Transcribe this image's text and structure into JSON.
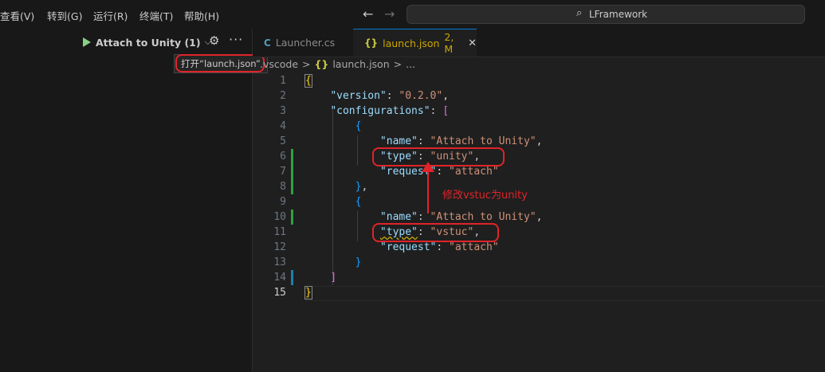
{
  "menu": [
    "查看(V)",
    "转到(G)",
    "运行(R)",
    "终端(T)",
    "帮助(H)"
  ],
  "nav": {
    "back": "←",
    "forward": "→"
  },
  "search": {
    "text": "LFramework"
  },
  "run": {
    "label": "Attach to Unity (1)"
  },
  "tooltip": {
    "text": "打开“launch.json”"
  },
  "tabs": [
    {
      "icon": "C",
      "label": "Launcher.cs"
    },
    {
      "icon": "{}",
      "label": "launch.json",
      "badge": "2, M",
      "close": "✕"
    }
  ],
  "breadcrumb": {
    "part1": ".vscode",
    "sep": ">",
    "icon": "{}",
    "part2": "launch.json",
    "part3": "..."
  },
  "line_numbers": [
    "1",
    "2",
    "3",
    "4",
    "5",
    "6",
    "7",
    "8",
    "9",
    "10",
    "11",
    "12",
    "13",
    "14",
    "15"
  ],
  "code": {
    "version_key": "\"version\"",
    "version_val": "\"0.2.0\"",
    "configs_key": "\"configurations\"",
    "name_key": "\"name\"",
    "name_val": "\"Attach to Unity\"",
    "type_key": "\"type\"",
    "type_val1": "\"unity\"",
    "type_val2": "\"vstuc\"",
    "request_key": "\"request\"",
    "request_val": "\"attach\""
  },
  "annotation": {
    "text": "修改vstuc为unity",
    "color": "#e0242a"
  }
}
